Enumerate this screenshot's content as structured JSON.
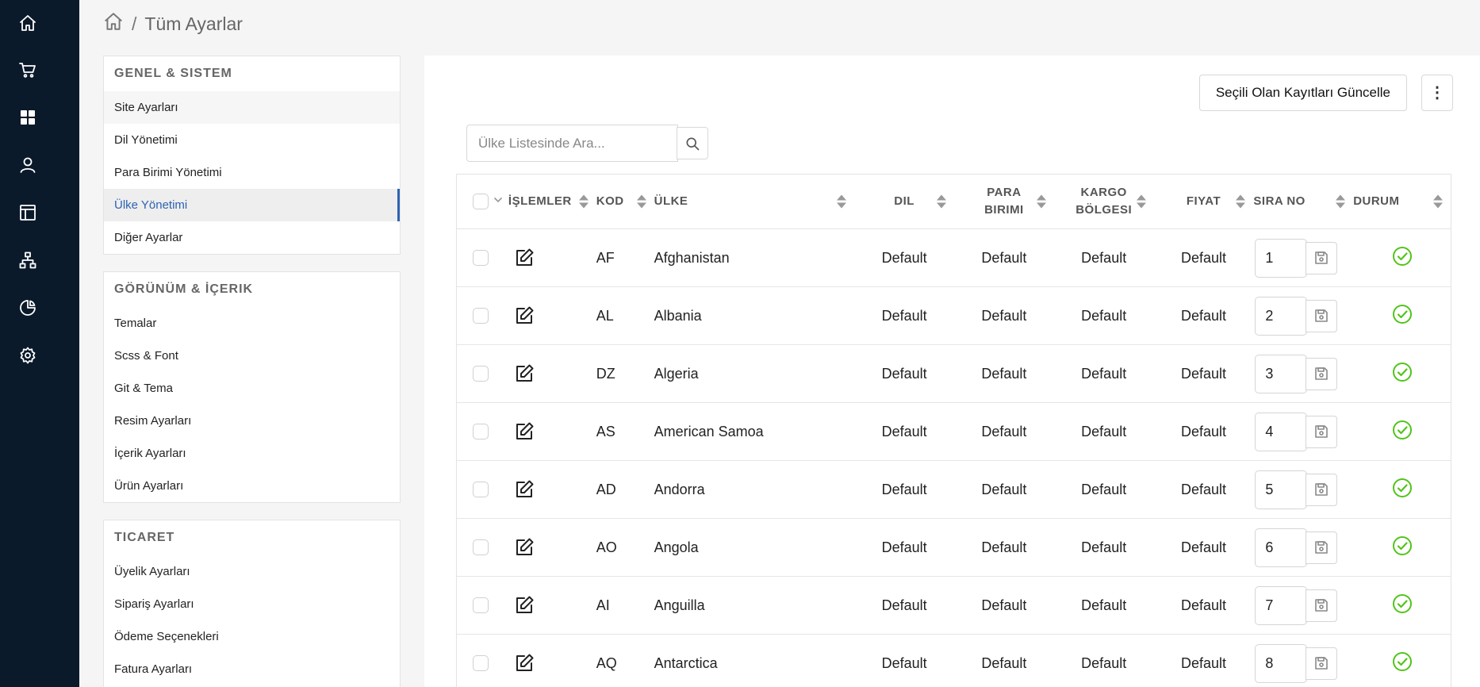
{
  "colors": {
    "rail_bg": "#0b1a2b",
    "active": "#2d63b3",
    "status_active": "#52c41a"
  },
  "rail": {
    "icons": [
      "home-icon",
      "cart-icon",
      "grid-icon",
      "user-icon",
      "layout-icon",
      "sitemap-icon",
      "pie-chart-icon",
      "settings-icon"
    ]
  },
  "breadcrumb": {
    "separator": "/",
    "current": "Tüm Ayarlar"
  },
  "nav": {
    "sections": [
      {
        "title": "GENEL & SISTEM",
        "items": [
          "Site Ayarları",
          "Dil Yönetimi",
          "Para Birimi Yönetimi",
          "Ülke Yönetimi",
          "Diğer Ayarlar"
        ]
      },
      {
        "title": "GÖRÜNÜM & İÇERIK",
        "items": [
          "Temalar",
          "Scss & Font",
          "Git & Tema",
          "Resim Ayarları",
          "İçerik Ayarları",
          "Ürün Ayarları"
        ]
      },
      {
        "title": "TICARET",
        "items": [
          "Üyelik Ayarları",
          "Sipariş Ayarları",
          "Ödeme Seçenekleri",
          "Fatura Ayarları"
        ]
      }
    ],
    "active_item": "Ülke Yönetimi"
  },
  "toolbar": {
    "update_label": "Seçili Olan Kayıtları Güncelle",
    "more_label": "⋮"
  },
  "search": {
    "placeholder": "Ülke Listesinde Ara..."
  },
  "table": {
    "headers": {
      "ops": "İŞLEMLER",
      "kod": "KOD",
      "ulke": "ÜLKE",
      "dil": "DIL",
      "para_1": "PARA",
      "para_2": "BIRIMI",
      "kargo_1": "KARGO",
      "kargo_2": "BÖLGESI",
      "fiyat": "FIYAT",
      "sira": "SIRA NO",
      "durum": "DURUM"
    },
    "rows": [
      {
        "kod": "AF",
        "ulke": "Afghanistan",
        "dil": "Default",
        "para": "Default",
        "kargo": "Default",
        "fiyat": "Default",
        "sira": "1",
        "durum": "active"
      },
      {
        "kod": "AL",
        "ulke": "Albania",
        "dil": "Default",
        "para": "Default",
        "kargo": "Default",
        "fiyat": "Default",
        "sira": "2",
        "durum": "active"
      },
      {
        "kod": "DZ",
        "ulke": "Algeria",
        "dil": "Default",
        "para": "Default",
        "kargo": "Default",
        "fiyat": "Default",
        "sira": "3",
        "durum": "active"
      },
      {
        "kod": "AS",
        "ulke": "American Samoa",
        "dil": "Default",
        "para": "Default",
        "kargo": "Default",
        "fiyat": "Default",
        "sira": "4",
        "durum": "active"
      },
      {
        "kod": "AD",
        "ulke": "Andorra",
        "dil": "Default",
        "para": "Default",
        "kargo": "Default",
        "fiyat": "Default",
        "sira": "5",
        "durum": "active"
      },
      {
        "kod": "AO",
        "ulke": "Angola",
        "dil": "Default",
        "para": "Default",
        "kargo": "Default",
        "fiyat": "Default",
        "sira": "6",
        "durum": "active"
      },
      {
        "kod": "AI",
        "ulke": "Anguilla",
        "dil": "Default",
        "para": "Default",
        "kargo": "Default",
        "fiyat": "Default",
        "sira": "7",
        "durum": "active"
      },
      {
        "kod": "AQ",
        "ulke": "Antarctica",
        "dil": "Default",
        "para": "Default",
        "kargo": "Default",
        "fiyat": "Default",
        "sira": "8",
        "durum": "active"
      }
    ]
  }
}
